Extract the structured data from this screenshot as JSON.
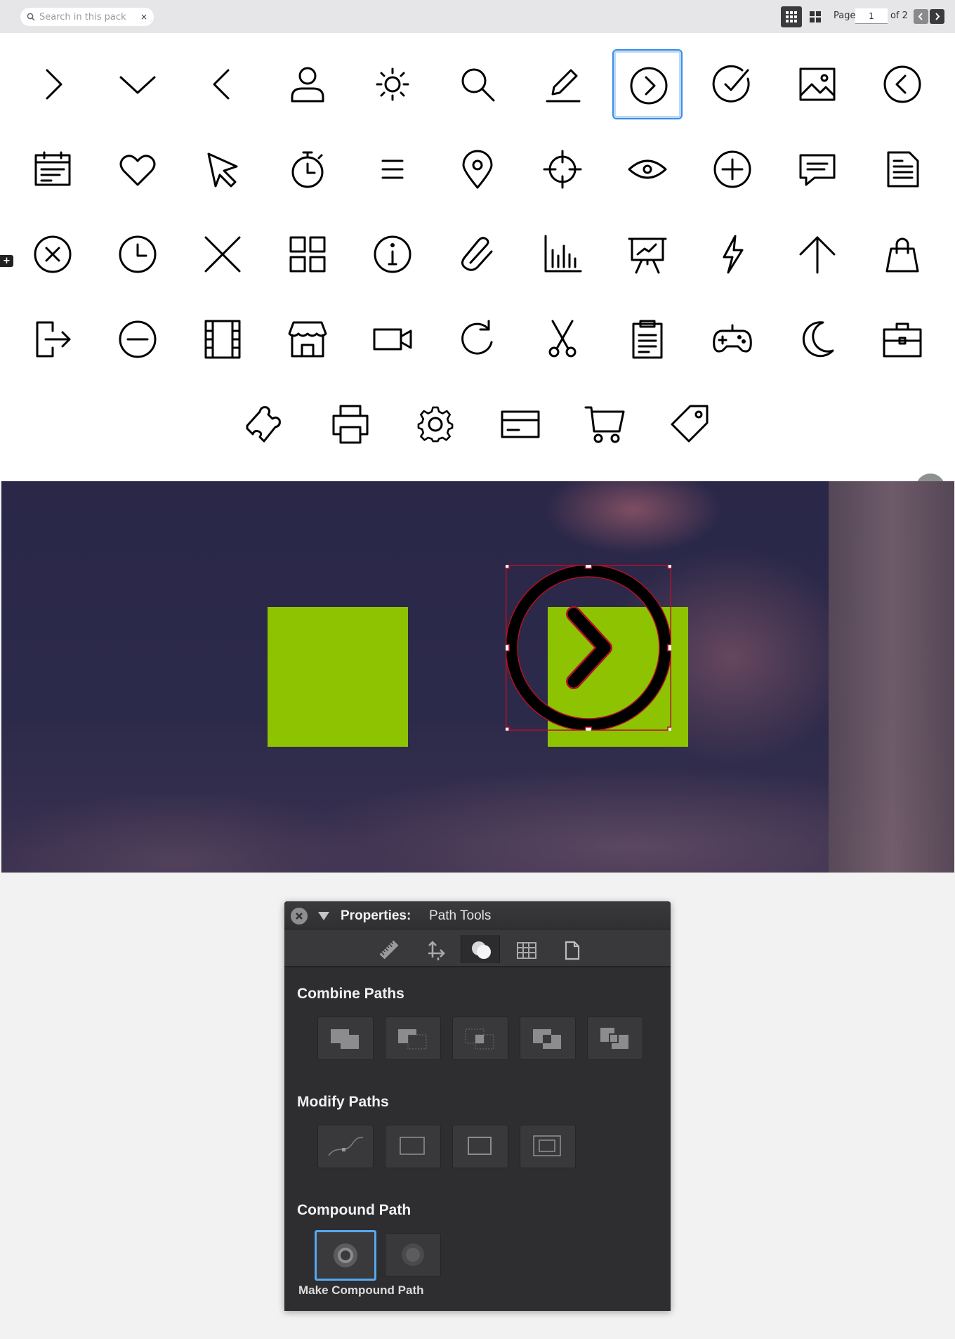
{
  "toolbar": {
    "search_placeholder": "Search in this pack",
    "clear_label": "×",
    "page_label": "Page",
    "page_value": "1",
    "page_of": "of 2"
  },
  "icon_grid": {
    "selected": "circle-chevron-right",
    "rows": [
      [
        "chevron-right",
        "chevron-down",
        "chevron-left",
        "user",
        "sun",
        "search",
        "pencil",
        "circle-chevron-right",
        "circle-check",
        "image",
        "circle-chevron-left"
      ],
      [
        "calendar",
        "heart",
        "cursor",
        "stopwatch",
        "menu",
        "map-pin",
        "crosshair",
        "eye",
        "circle-plus",
        "chat",
        "document"
      ],
      [
        "circle-x",
        "clock",
        "close",
        "grid",
        "info",
        "paperclip",
        "bar-chart",
        "presentation",
        "lightning",
        "arrow-up",
        "shopping-bag"
      ],
      [
        "logout",
        "circle-minus",
        "film",
        "store",
        "video-camera",
        "refresh",
        "scissors",
        "clipboard",
        "gamepad",
        "moon",
        "briefcase"
      ],
      [
        "puzzle",
        "printer",
        "gear",
        "credit-card",
        "shopping-cart",
        "tag"
      ]
    ]
  },
  "sidetab_label": "+",
  "canvas": {
    "shape_color": "#8dc300",
    "selection_color": "#c8202a",
    "selected_object": "circle-chevron-right"
  },
  "panel": {
    "title_label": "Properties:",
    "title_value": "Path Tools",
    "tabs": [
      "ruler-icon",
      "transform-icon",
      "path-tools-icon",
      "grid-icon",
      "document-icon"
    ],
    "active_tab": "path-tools-icon",
    "combine_title": "Combine Paths",
    "modify_title": "Modify Paths",
    "compound_title": "Compound Path",
    "active_caption": "Make Compound Path"
  }
}
